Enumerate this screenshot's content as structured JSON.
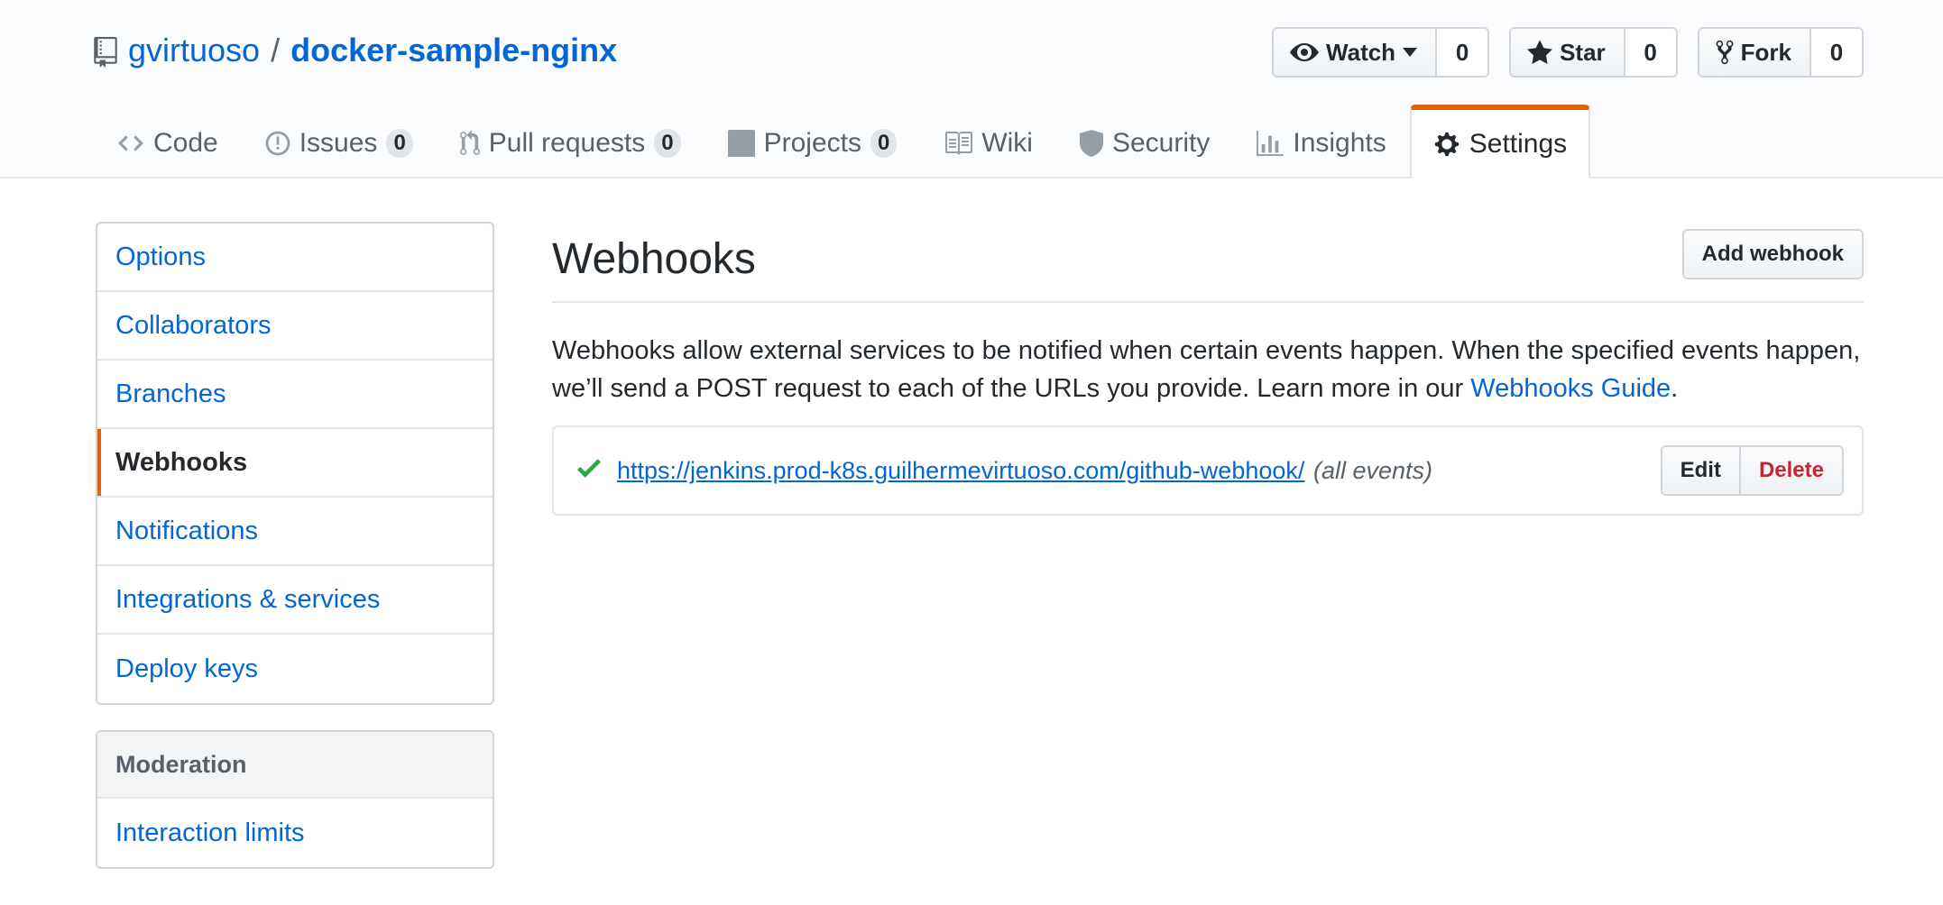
{
  "header": {
    "owner": "gvirtuoso",
    "separator": "/",
    "repo": "docker-sample-nginx",
    "repo_icon": "repo-icon",
    "actions": {
      "watch_label": "Watch",
      "watch_count": "0",
      "star_label": "Star",
      "star_count": "0",
      "fork_label": "Fork",
      "fork_count": "0"
    }
  },
  "reponav": {
    "items": [
      {
        "label": "Code",
        "icon": "code-icon"
      },
      {
        "label": "Issues",
        "icon": "issue-icon",
        "count": "0"
      },
      {
        "label": "Pull requests",
        "icon": "pull-request-icon",
        "count": "0"
      },
      {
        "label": "Projects",
        "icon": "project-icon",
        "count": "0"
      },
      {
        "label": "Wiki",
        "icon": "book-icon"
      },
      {
        "label": "Security",
        "icon": "shield-icon"
      },
      {
        "label": "Insights",
        "icon": "graph-icon"
      },
      {
        "label": "Settings",
        "icon": "gear-icon",
        "selected": true
      }
    ]
  },
  "sidebar": {
    "items": [
      {
        "label": "Options"
      },
      {
        "label": "Collaborators"
      },
      {
        "label": "Branches"
      },
      {
        "label": "Webhooks",
        "selected": true
      },
      {
        "label": "Notifications"
      },
      {
        "label": "Integrations & services"
      },
      {
        "label": "Deploy keys"
      }
    ],
    "moderation": {
      "heading": "Moderation",
      "items": [
        {
          "label": "Interaction limits"
        }
      ]
    }
  },
  "main": {
    "title": "Webhooks",
    "add_button": "Add webhook",
    "intro_text": "Webhooks allow external services to be notified when certain events happen. When the specified events happen, we’ll send a POST request to each of the URLs you provide. Learn more in our ",
    "intro_link": "Webhooks Guide",
    "intro_end": ".",
    "hooks": [
      {
        "status_icon": "check-icon",
        "url": "https://jenkins.prod-k8s.guilhermevirtuoso.com/github-webhook/",
        "events": "(all events)",
        "edit_label": "Edit",
        "delete_label": "Delete"
      }
    ]
  },
  "colors": {
    "link": "#0366d6",
    "selected_accent": "#e36209",
    "success": "#28a745",
    "danger": "#cb2431"
  }
}
